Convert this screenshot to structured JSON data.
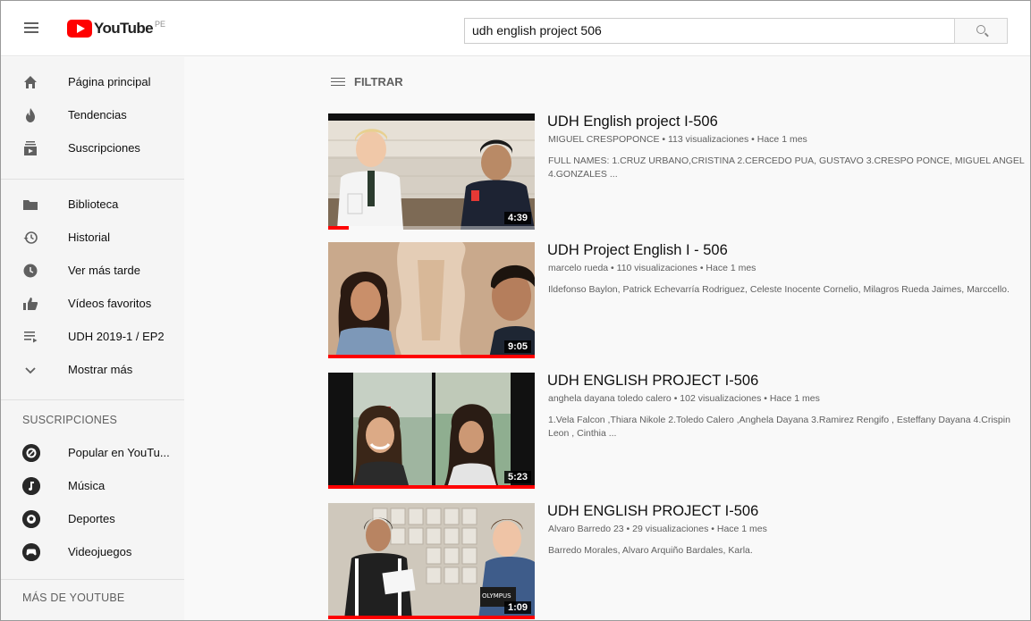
{
  "header": {
    "logo_text": "YouTube",
    "country_code": "PE",
    "search_value": "udh english project 506"
  },
  "sidebar": {
    "main_items": [
      {
        "label": "Página principal",
        "icon": "home-icon"
      },
      {
        "label": "Tendencias",
        "icon": "flame-icon"
      },
      {
        "label": "Suscripciones",
        "icon": "subscriptions-icon"
      }
    ],
    "library_items": [
      {
        "label": "Biblioteca",
        "icon": "folder-icon"
      },
      {
        "label": "Historial",
        "icon": "history-icon"
      },
      {
        "label": "Ver más tarde",
        "icon": "clock-icon"
      },
      {
        "label": "Vídeos favoritos",
        "icon": "thumbs-up-icon"
      },
      {
        "label": "UDH 2019-1 / EP2",
        "icon": "playlist-icon"
      },
      {
        "label": "Mostrar más",
        "icon": "chevron-down-icon"
      }
    ],
    "subscriptions_title": "SUSCRIPCIONES",
    "subscriptions": [
      {
        "label": "Popular en YouTu..."
      },
      {
        "label": "Música"
      },
      {
        "label": "Deportes"
      },
      {
        "label": "Videojuegos"
      }
    ],
    "more_title": "MÁS DE YOUTUBE"
  },
  "content": {
    "filter_label": "FILTRAR",
    "videos": [
      {
        "title": "UDH English project I-506",
        "meta": "MIGUEL CRESPOPONCE • 113 visualizaciones • Hace 1 mes",
        "description": "FULL NAMES: 1.CRUZ URBANO,CRISTINA 2.CERCEDO PUA, GUSTAVO 3.CRESPO PONCE, MIGUEL ANGEL 4.GONZALES ...",
        "duration": "4:39",
        "watched_fraction": 0.1
      },
      {
        "title": "UDH Project English I - 506",
        "meta": "marcelo rueda • 110 visualizaciones • Hace 1 mes",
        "description": "Ildefonso Baylon, Patrick Echevarría Rodriguez, Celeste Inocente Cornelio, Milagros Rueda Jaimes, Marccello.",
        "duration": "9:05",
        "watched_fraction": 1.0
      },
      {
        "title": "UDH ENGLISH PROJECT I-506",
        "meta": "anghela dayana toledo calero • 102 visualizaciones • Hace 1 mes",
        "description": "1.Vela Falcon ,Thiara Nikole 2.Toledo Calero ,Anghela Dayana 3.Ramirez Rengifo , Esteffany Dayana 4.Crispin Leon , Cinthia ...",
        "duration": "5:23",
        "watched_fraction": 1.0
      },
      {
        "title": "UDH ENGLISH PROJECT I-506",
        "meta": "Alvaro Barredo 23 • 29 visualizaciones • Hace 1 mes",
        "description": "Barredo Morales, Alvaro Arquiño Bardales, Karla.",
        "duration": "1:09",
        "watched_fraction": 1.0,
        "thumb_text": "OLYMPUS"
      }
    ]
  }
}
